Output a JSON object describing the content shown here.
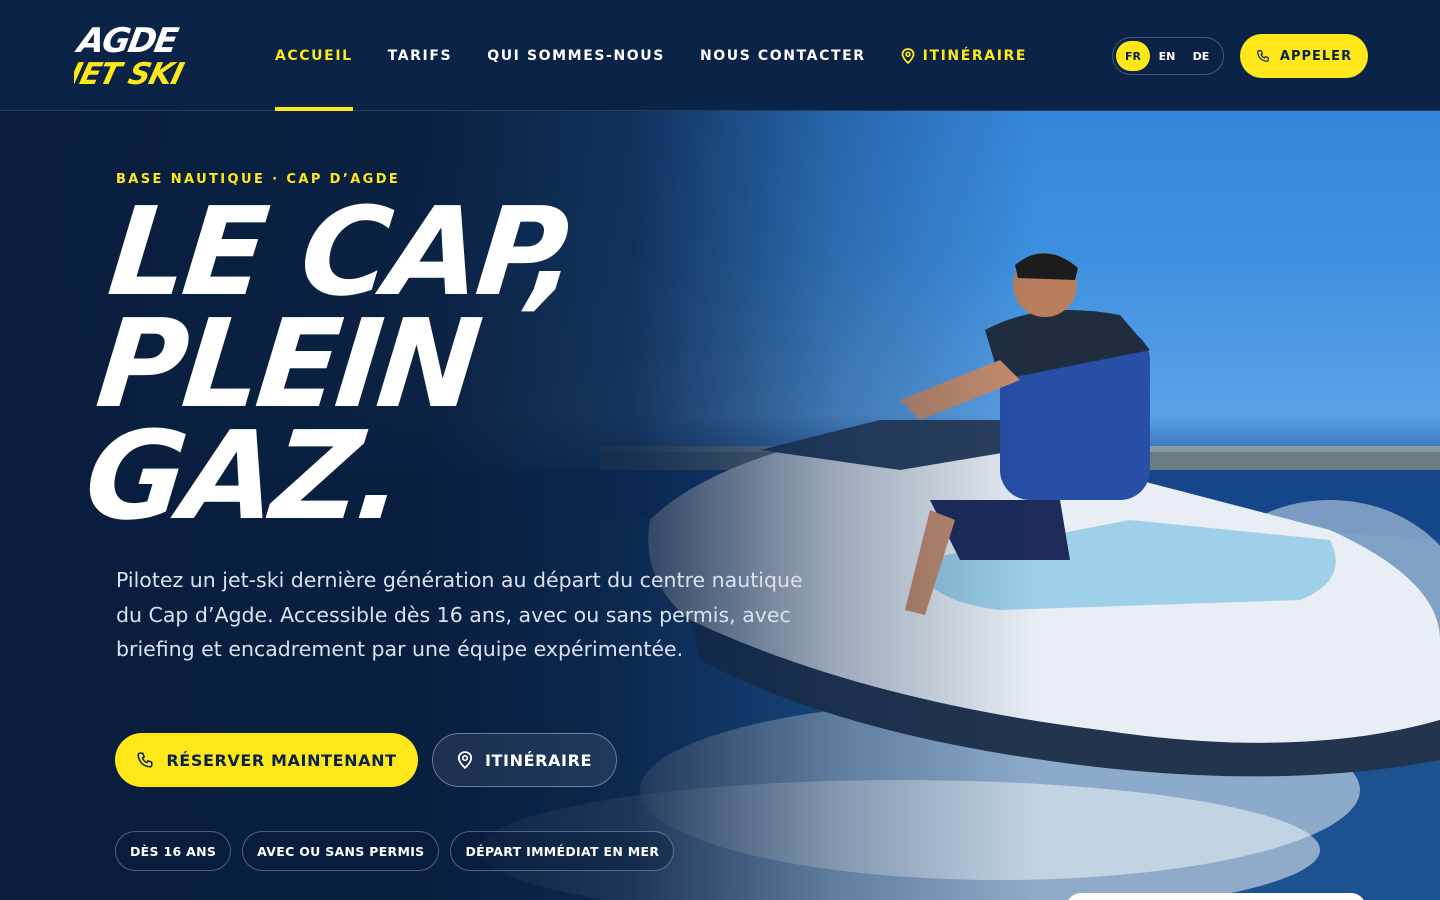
{
  "brand": {
    "logo_line1": "AGDE",
    "logo_line2": "JET SKI",
    "accent_color": "#ffe81a",
    "navy_color": "#0a2347"
  },
  "nav": {
    "items": [
      {
        "label": "ACCUEIL",
        "active": true
      },
      {
        "label": "TARIFS",
        "active": false
      },
      {
        "label": "QUI SOMMES-NOUS",
        "active": false
      },
      {
        "label": "NOUS CONTACTER",
        "active": false
      }
    ],
    "itinerary": {
      "label": "ITINÉRAIRE",
      "icon": "map-pin-icon"
    }
  },
  "languages": {
    "options": [
      "FR",
      "EN",
      "DE"
    ],
    "selected": "FR"
  },
  "header_cta": {
    "label": "APPELER",
    "icon": "phone-icon"
  },
  "hero": {
    "eyebrow": "BASE NAUTIQUE · CAP D’AGDE",
    "headline": [
      "LE CAP,",
      "PLEIN",
      "GAZ."
    ],
    "lead": "Pilotez un jet-ski dernière génération au départ du centre nautique du Cap d’Agde. Accessible dès 16 ans, avec ou sans permis, avec briefing et encadrement par une équipe expérimentée.",
    "primary_button": {
      "label": "RÉSERVER MAINTENANT",
      "icon": "phone-icon"
    },
    "secondary_button": {
      "label": "ITINÉRAIRE",
      "icon": "map-pin-icon"
    },
    "chips": [
      "DÈS 16 ANS",
      "AVEC OU SANS PERMIS",
      "DÉPART IMMÉDIAT EN MER"
    ]
  }
}
